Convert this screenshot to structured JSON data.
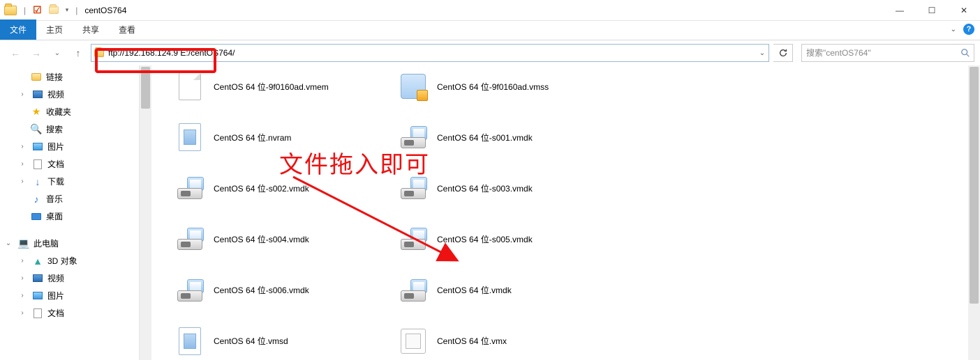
{
  "window": {
    "title": "centOS764"
  },
  "ribbon": {
    "file": "文件",
    "tabs": [
      "主页",
      "共享",
      "查看"
    ]
  },
  "nav": {
    "address": "ftp://192.168.124.9 E:/centOS764/",
    "search_placeholder": "搜索\"centOS764\""
  },
  "annotation": {
    "text": "文件拖入即可"
  },
  "tree": [
    {
      "icon": "folder",
      "label": "链接",
      "depth": 0
    },
    {
      "icon": "video",
      "label": "视频",
      "depth": 0,
      "expander": ">"
    },
    {
      "icon": "star",
      "label": "收藏夹",
      "depth": 0
    },
    {
      "icon": "search",
      "label": "搜索",
      "depth": 0
    },
    {
      "icon": "pic",
      "label": "图片",
      "depth": 0,
      "expander": ">"
    },
    {
      "icon": "doc",
      "label": "文档",
      "depth": 0,
      "expander": ">"
    },
    {
      "icon": "dl",
      "label": "下载",
      "depth": 0,
      "expander": ">"
    },
    {
      "icon": "music",
      "label": "音乐",
      "depth": 0
    },
    {
      "icon": "desktop",
      "label": "桌面",
      "depth": 0
    },
    {
      "icon": "pc",
      "label": "此电脑",
      "depth": 1,
      "expander": "v"
    },
    {
      "icon": "3d",
      "label": "3D 对象",
      "depth": 2,
      "expander": ">"
    },
    {
      "icon": "video",
      "label": "视频",
      "depth": 2,
      "expander": ">"
    },
    {
      "icon": "pic",
      "label": "图片",
      "depth": 2,
      "expander": ">"
    },
    {
      "icon": "doc",
      "label": "文档",
      "depth": 2,
      "expander": ">"
    }
  ],
  "files": {
    "col1": [
      {
        "type": "blank",
        "name": "CentOS 64 位-9f0160ad.vmem"
      },
      {
        "type": "nvram",
        "name": "CentOS 64 位.nvram"
      },
      {
        "type": "vmdk",
        "name": "CentOS 64 位-s002.vmdk"
      },
      {
        "type": "vmdk",
        "name": "CentOS 64 位-s004.vmdk"
      },
      {
        "type": "vmdk",
        "name": "CentOS 64 位-s006.vmdk"
      },
      {
        "type": "vmsd",
        "name": "CentOS 64 位.vmsd"
      }
    ],
    "col2": [
      {
        "type": "vmss",
        "name": "CentOS 64 位-9f0160ad.vmss"
      },
      {
        "type": "vmdk",
        "name": "CentOS 64 位-s001.vmdk"
      },
      {
        "type": "vmdk",
        "name": "CentOS 64 位-s003.vmdk"
      },
      {
        "type": "vmdk",
        "name": "CentOS 64 位-s005.vmdk"
      },
      {
        "type": "vmdk",
        "name": "CentOS 64 位.vmdk"
      },
      {
        "type": "vmx",
        "name": "CentOS 64 位.vmx"
      }
    ]
  }
}
